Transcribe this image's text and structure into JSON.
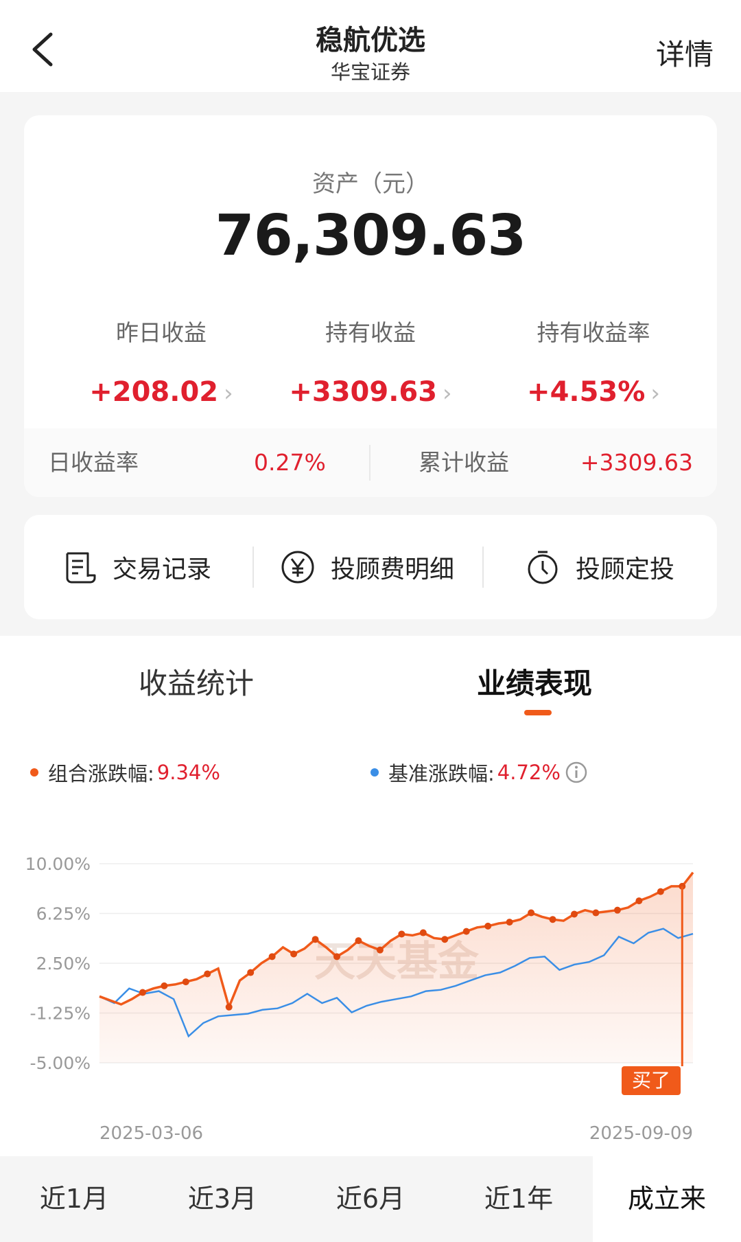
{
  "header": {
    "title": "稳航优选",
    "subtitle": "华宝证券",
    "detail_label": "详情"
  },
  "asset": {
    "label": "资产（元）",
    "value": "76,309.63",
    "stats": [
      {
        "label": "昨日收益",
        "value": "+208.02"
      },
      {
        "label": "持有收益",
        "value": "+3309.63"
      },
      {
        "label": "持有收益率",
        "value": "+4.53%"
      }
    ],
    "daily_rate_label": "日收益率",
    "daily_rate_value": "0.27%",
    "cumulative_label": "累计收益",
    "cumulative_value": "+3309.63"
  },
  "actions": [
    {
      "label": "交易记录",
      "icon": "receipt-icon"
    },
    {
      "label": "投顾费明细",
      "icon": "yen-icon"
    },
    {
      "label": "投顾定投",
      "icon": "timer-icon"
    }
  ],
  "tabs": {
    "stats": "收益统计",
    "performance": "业绩表现",
    "active": "业绩表现"
  },
  "legend": {
    "portfolio_label": "组合涨跌幅:",
    "portfolio_value": "9.34%",
    "benchmark_label": "基准涨跌幅:",
    "benchmark_value": "4.72%"
  },
  "colors": {
    "portfolio": "#f05a1a",
    "benchmark": "#3a8ee6",
    "gain": "#e0202e",
    "accent": "#f05a1a"
  },
  "chart_data": {
    "type": "line",
    "y_ticks": [
      "10.00%",
      "6.25%",
      "2.50%",
      "-1.25%",
      "-5.00%"
    ],
    "ylim": [
      -5.0,
      10.0
    ],
    "x_start_label": "2025-03-06",
    "x_end_label": "2025-09-09",
    "watermark": "天天基金",
    "buy_marker": "买了",
    "series": [
      {
        "name": "组合涨跌幅",
        "values": [
          0.0,
          -0.3,
          -0.6,
          -0.2,
          0.3,
          0.6,
          0.8,
          0.9,
          1.1,
          1.3,
          1.7,
          2.1,
          -0.8,
          1.2,
          1.8,
          2.5,
          3.0,
          3.7,
          3.2,
          3.6,
          4.3,
          3.7,
          3.0,
          3.5,
          4.2,
          3.8,
          3.5,
          4.2,
          4.7,
          4.6,
          4.8,
          4.4,
          4.3,
          4.6,
          4.9,
          5.2,
          5.3,
          5.5,
          5.6,
          5.8,
          6.3,
          6.0,
          5.8,
          5.7,
          6.2,
          6.5,
          6.3,
          6.4,
          6.5,
          6.7,
          7.2,
          7.5,
          7.9,
          8.3,
          8.3,
          9.34
        ],
        "color": "#f05a1a"
      },
      {
        "name": "基准涨跌幅",
        "values": [
          0.0,
          -0.5,
          0.6,
          0.2,
          0.4,
          -0.2,
          -3.0,
          -2.0,
          -1.5,
          -1.4,
          -1.3,
          -1.0,
          -0.9,
          -0.5,
          0.2,
          -0.5,
          -0.1,
          -1.2,
          -0.7,
          -0.4,
          -0.2,
          0.0,
          0.4,
          0.5,
          0.8,
          1.2,
          1.6,
          1.8,
          2.3,
          2.9,
          3.0,
          2.0,
          2.4,
          2.6,
          3.1,
          4.5,
          4.0,
          4.8,
          5.1,
          4.4,
          4.72
        ],
        "color": "#3a8ee6"
      }
    ]
  },
  "ranges": [
    {
      "label": "近1月"
    },
    {
      "label": "近3月"
    },
    {
      "label": "近6月"
    },
    {
      "label": "近1年"
    },
    {
      "label": "成立来"
    }
  ],
  "active_range": "成立来"
}
